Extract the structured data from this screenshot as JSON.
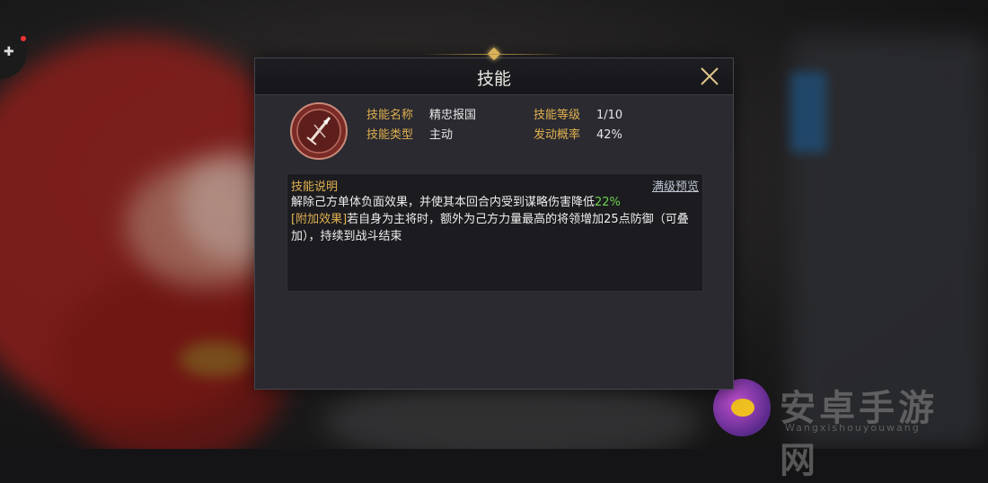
{
  "dialog": {
    "title": "技能",
    "close_icon": "close-x-icon"
  },
  "skill": {
    "emblem_icon": "crossed-spear-emblem-icon",
    "name_label": "技能名称",
    "name_value": "精忠报国",
    "level_label": "技能等级",
    "level_value": "1/10",
    "type_label": "技能类型",
    "type_value": "主动",
    "chance_label": "发动概率",
    "chance_value": "42%"
  },
  "description": {
    "header": "技能说明",
    "preview_link": "满级预览",
    "line1_text": "解除己方单体负面效果，并使其本回合内受到谋略伤害降低",
    "line1_highlight": "22%",
    "bonus_tag": "[附加效果]",
    "bonus_text": "若自身为主将时，额外为己方力量最高的将领增加25点防御（可叠加），持续到战斗结束"
  },
  "watermark": {
    "title": "安卓手游网",
    "subtitle": "Wangxishouyouwang"
  },
  "colors": {
    "accent_gold": "#e0b050",
    "highlight_green": "#6cd04e",
    "panel_bg": "#2a2a30"
  }
}
